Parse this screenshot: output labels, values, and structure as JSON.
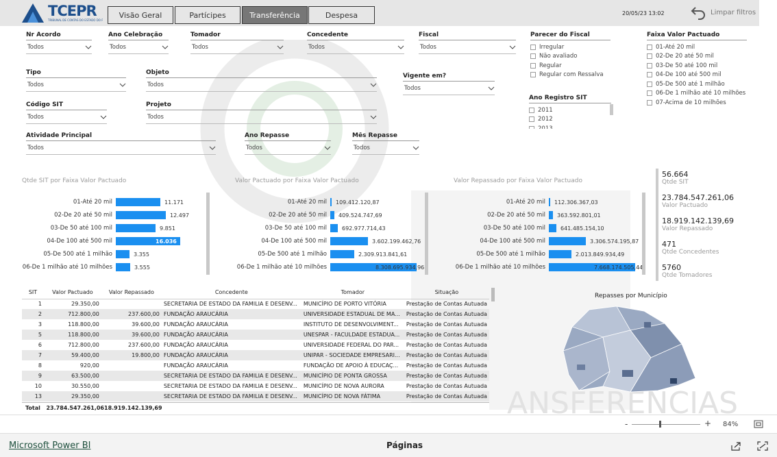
{
  "header": {
    "logo_text": "TCEPR",
    "logo_subtitle": "TRIBUNAL DE CONTAS DO ESTADO DO PARANÁ",
    "nav": [
      "Visão Geral",
      "Partícipes",
      "Transferência",
      "Despesa"
    ],
    "active_nav": "Transferência",
    "timestamp": "20/05/23 13:02",
    "clear_filters": "Limpar filtros"
  },
  "filters": {
    "nr_acordo": {
      "label": "Nr Acordo",
      "value": "Todos"
    },
    "ano_celebracao": {
      "label": "Ano Celebração",
      "value": "Todos"
    },
    "tomador": {
      "label": "Tomador",
      "value": "Todos"
    },
    "concedente": {
      "label": "Concedente",
      "value": "Todos"
    },
    "fiscal": {
      "label": "Fiscal",
      "value": "Todos"
    },
    "tipo": {
      "label": "Tipo",
      "value": "Todos"
    },
    "objeto": {
      "label": "Objeto",
      "value": "Todos"
    },
    "vigente": {
      "label": "Vigente em?",
      "value": "Todos"
    },
    "codigo_sit": {
      "label": "Código SIT",
      "value": "Todos"
    },
    "projeto": {
      "label": "Projeto",
      "value": "Todos"
    },
    "atividade": {
      "label": "Atividade Principal",
      "value": "Todos"
    },
    "ano_repasse": {
      "label": "Ano Repasse",
      "value": "Todos"
    },
    "mes_repasse": {
      "label": "Mês Repasse",
      "value": "Todos"
    },
    "parecer": {
      "label": "Parecer do Fiscal",
      "options": [
        "Irregular",
        "Não avaliado",
        "Regular",
        "Regular com Ressalva"
      ]
    },
    "ano_registro": {
      "label": "Ano Registro SIT",
      "options": [
        "2011",
        "2012",
        "2013"
      ]
    },
    "faixa": {
      "label": "Faixa Valor Pactuado",
      "options": [
        "01-Até 20 mil",
        "02-De 20 até 50 mil",
        "03-De 50 até 100 mil",
        "04-De 100 até 500 mil",
        "05-De 500 até 1 milhão",
        "06-De 1 milhão até 10 milhões",
        "07-Acima de 10 milhões"
      ]
    }
  },
  "chart_data": [
    {
      "type": "bar",
      "title": "Qtde SIT por Faixa Valor Pactuado",
      "categories": [
        "01-Até 20 mil",
        "02-De 20 até 50 mil",
        "03-De 50 até 100 mil",
        "04-De 100 até 500 mil",
        "05-De 500 até 1 milhão",
        "06-De 1 milhão até 10 milhões"
      ],
      "values": [
        11171,
        12497,
        9851,
        16036,
        3355,
        3555
      ],
      "labels": [
        "11.171",
        "12.497",
        "9.851",
        "16.036",
        "3.355",
        "3.555"
      ]
    },
    {
      "type": "bar",
      "title": "Valor Pactuado por Faixa Valor Pactuado",
      "categories": [
        "01-Até 20 mil",
        "02-De 20 até 50 mil",
        "03-De 50 até 100 mil",
        "04-De 100 até 500 mil",
        "05-De 500 até 1 milhão",
        "06-De 1 milhão até 10 milhões"
      ],
      "values": [
        109412120.87,
        409524747.69,
        692977714.43,
        3602199462.76,
        2309913841.61,
        8308695934.96
      ],
      "labels": [
        "109.412.120,87",
        "409.524.747,69",
        "692.977.714,43",
        "3.602.199.462,76",
        "2.309.913.841,61",
        "8.308.695.934,96"
      ]
    },
    {
      "type": "bar",
      "title": "Valor Repassado por Faixa Valor Pactuado",
      "categories": [
        "01-Até 20 mil",
        "02-De 20 até 50 mil",
        "03-De 50 até 100 mil",
        "04-De 100 até 500 mil",
        "05-De 500 até 1 milhão",
        "06-De 1 milhão até 10 milhões"
      ],
      "values": [
        112306367.03,
        363592801.01,
        641485154.1,
        3306574195.87,
        2013849934.49,
        7668174505.44
      ],
      "labels": [
        "112.306.367,03",
        "363.592.801,01",
        "641.485.154,10",
        "3.306.574.195,87",
        "2.013.849.934,49",
        "7.668.174.505,44"
      ]
    }
  ],
  "kpis": [
    {
      "value": "56.664",
      "label": "Qtde SIT"
    },
    {
      "value": "23.784.547.261,06",
      "label": "Valor Pactuado"
    },
    {
      "value": "18.919.142.139,69",
      "label": "Valor Repassado"
    },
    {
      "value": "471",
      "label": "Qtde Concedentes"
    },
    {
      "value": "5760",
      "label": "Qtde Tomadores"
    }
  ],
  "table": {
    "headers": [
      "SIT",
      "Valor Pactuado",
      "Valor Repassado",
      "Concedente",
      "Tomador",
      "Situação"
    ],
    "rows": [
      [
        "1",
        "29.350,00",
        "",
        "SECRETARIA DE ESTADO DA FAMILIA E DESENV...",
        "MUNICÍPIO DE PORTO VITÓRIA",
        "Prestação de Contas Autuada"
      ],
      [
        "2",
        "712.800,00",
        "237.600,00",
        "FUNDAÇÃO ARAUCÁRIA",
        "UNIVERSIDADE ESTADUAL DE MA...",
        "Prestação de Contas Autuada"
      ],
      [
        "3",
        "118.800,00",
        "39.600,00",
        "FUNDAÇÃO ARAUCÁRIA",
        "INSTITUTO DE DESENVOLVIMENT...",
        "Prestação de Contas Autuada"
      ],
      [
        "5",
        "118.800,00",
        "39.600,00",
        "FUNDAÇÃO ARAUCÁRIA",
        "UNESPAR - FACULDADE ESTADUA...",
        "Prestação de Contas Autuada"
      ],
      [
        "6",
        "712.800,00",
        "237.600,00",
        "FUNDAÇÃO ARAUCÁRIA",
        "UNIVERSIDADE FEDERAL DO PAR...",
        "Prestação de Contas Autuada"
      ],
      [
        "7",
        "59.400,00",
        "19.800,00",
        "FUNDAÇÃO ARAUCÁRIA",
        "UNIPAR - SOCIEDADE EMPRESARI...",
        "Prestação de Contas Autuada"
      ],
      [
        "8",
        "920,00",
        "",
        "FUNDAÇÃO ARAUCÁRIA",
        "FUNDAÇÃO DE APOIO À EDUCAÇ...",
        "Prestação de Contas Autuada"
      ],
      [
        "9",
        "63.500,00",
        "",
        "SECRETARIA DE ESTADO DA FAMILIA E DESENV...",
        "MUNICÍPIO DE PONTA GROSSA",
        "Prestação de Contas Autuada"
      ],
      [
        "10",
        "30.550,00",
        "",
        "SECRETARIA DE ESTADO DA FAMILIA E DESENV...",
        "MUNICÍPIO DE NOVA AURORA",
        "Prestação de Contas Autuada"
      ],
      [
        "13",
        "29.350,00",
        "",
        "SECRETARIA DE ESTADO DA FAMILIA E DESENV...",
        "MUNICÍPIO DE NOVA FÁTIMA",
        "Prestação de Contas Autuada"
      ]
    ],
    "total_label": "Total",
    "total_pactuado": "23.784.547.261,06",
    "total_repassado": "18.919.142.139,69"
  },
  "map": {
    "title": "Repasses por Município"
  },
  "watermark_text": "ANSFERÊNCIAS",
  "status": {
    "zoom": "84%",
    "zoom_level": 0.35
  },
  "footer": {
    "powerbi": "Microsoft Power BI",
    "pages": "Páginas"
  },
  "colors": {
    "accent": "#1a8ff0",
    "brand": "#1d4f8c",
    "nav_active": "#777777"
  }
}
